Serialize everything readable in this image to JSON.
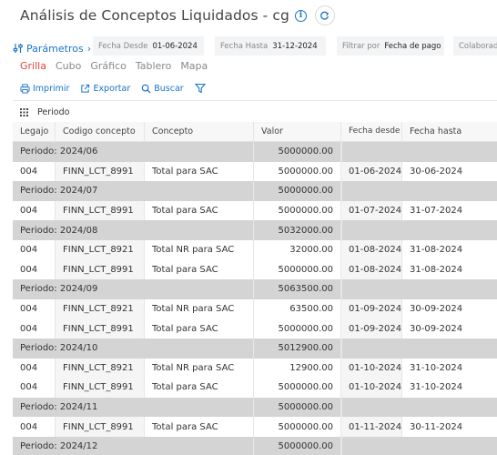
{
  "header": {
    "title": "Análisis de Conceptos Liquidados - cg",
    "info_icon": "info-icon",
    "refresh_icon": "refresh-icon"
  },
  "params": {
    "label": "Parámetros",
    "chevron": "›",
    "filters": [
      {
        "label": "Fecha Desde",
        "value": "01-06-2024"
      },
      {
        "label": "Fecha Hasta",
        "value": "31-12-2024"
      },
      {
        "label": "Filtrar por",
        "value": "Fecha de pago"
      },
      {
        "label": "Colaborad",
        "value": ""
      }
    ]
  },
  "tabs": [
    "Grilla",
    "Cubo",
    "Gráfico",
    "Tablero",
    "Mapa"
  ],
  "active_tab": "Grilla",
  "toolbar": {
    "print_label": "Imprimir",
    "export_label": "Exportar",
    "search_label": "Buscar"
  },
  "group_by": "Periodo",
  "columns": [
    "Legajo",
    "Codigo concepto",
    "Concepto",
    "Valor",
    "Fecha desde",
    "Fecha hasta"
  ],
  "rows": [
    {
      "type": "period",
      "label": "Periodo: 2024/06",
      "value": "5000000.00"
    },
    {
      "type": "data",
      "legajo": "004",
      "codigo": "FINN_LCT_8991",
      "concepto": "Total para SAC",
      "valor": "5000000.00",
      "desde": "01-06-2024",
      "hasta": "30-06-2024"
    },
    {
      "type": "period",
      "label": "Periodo: 2024/07",
      "value": "5000000.00"
    },
    {
      "type": "data",
      "legajo": "004",
      "codigo": "FINN_LCT_8991",
      "concepto": "Total para SAC",
      "valor": "5000000.00",
      "desde": "01-07-2024",
      "hasta": "31-07-2024"
    },
    {
      "type": "period",
      "label": "Periodo: 2024/08",
      "value": "5032000.00"
    },
    {
      "type": "data",
      "legajo": "004",
      "codigo": "FINN_LCT_8921",
      "concepto": "Total NR para SAC",
      "valor": "32000.00",
      "desde": "01-08-2024",
      "hasta": "31-08-2024"
    },
    {
      "type": "data",
      "legajo": "004",
      "codigo": "FINN_LCT_8991",
      "concepto": "Total para SAC",
      "valor": "5000000.00",
      "desde": "01-08-2024",
      "hasta": "31-08-2024"
    },
    {
      "type": "period",
      "label": "Periodo: 2024/09",
      "value": "5063500.00"
    },
    {
      "type": "data",
      "legajo": "004",
      "codigo": "FINN_LCT_8921",
      "concepto": "Total NR para SAC",
      "valor": "63500.00",
      "desde": "01-09-2024",
      "hasta": "30-09-2024"
    },
    {
      "type": "data",
      "legajo": "004",
      "codigo": "FINN_LCT_8991",
      "concepto": "Total para SAC",
      "valor": "5000000.00",
      "desde": "01-09-2024",
      "hasta": "30-09-2024"
    },
    {
      "type": "period",
      "label": "Periodo: 2024/10",
      "value": "5012900.00"
    },
    {
      "type": "data",
      "legajo": "004",
      "codigo": "FINN_LCT_8921",
      "concepto": "Total NR para SAC",
      "valor": "12900.00",
      "desde": "01-10-2024",
      "hasta": "31-10-2024"
    },
    {
      "type": "data",
      "legajo": "004",
      "codigo": "FINN_LCT_8991",
      "concepto": "Total para SAC",
      "valor": "5000000.00",
      "desde": "01-10-2024",
      "hasta": "31-10-2024"
    },
    {
      "type": "period",
      "label": "Periodo: 2024/11",
      "value": "5000000.00"
    },
    {
      "type": "data",
      "legajo": "004",
      "codigo": "FINN_LCT_8991",
      "concepto": "Total para SAC",
      "valor": "5000000.00",
      "desde": "01-11-2024",
      "hasta": "30-11-2024"
    },
    {
      "type": "period",
      "label": "Periodo: 2024/12",
      "value": "5000000.00"
    }
  ],
  "colors": {
    "accent": "#1a73c8",
    "active_tab": "#e0443c",
    "period_row": "#d4d4d4"
  }
}
